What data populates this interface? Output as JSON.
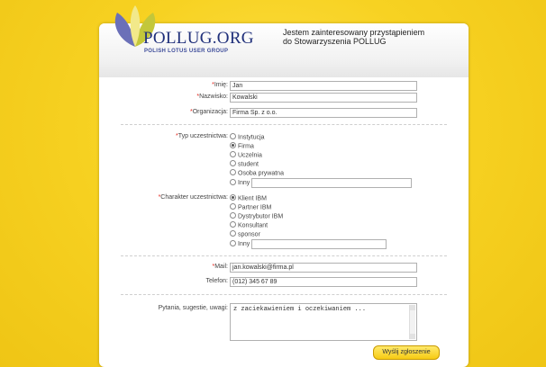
{
  "header": {
    "logo_text": "POLLUG.ORG",
    "logo_sub": "POLISH LOTUS USER GROUP",
    "title_line1": "Jestem zainteresowany przystąpieniem",
    "title_line2": "do Stowarzyszenia POLLUG"
  },
  "form": {
    "imie": {
      "label": "Imię:",
      "value": "Jan"
    },
    "nazwisko": {
      "label": "Nazwisko:",
      "value": "Kowalski"
    },
    "organizacja": {
      "label": "Organizacja:",
      "value": "Firma Sp. z o.o."
    },
    "typ": {
      "label": "Typ uczestnictwa:",
      "options": [
        "Instytucja",
        "Firma",
        "Uczelnia",
        "student",
        "Osoba prywatna",
        "Inny"
      ],
      "selected": "Firma"
    },
    "charakter": {
      "label": "Charakter uczestnictwa:",
      "options": [
        "Klient IBM",
        "Partner IBM",
        "Dystrybutor IBM",
        "Konsultant",
        "sponsor",
        "Inny"
      ],
      "selected": "Klient IBM"
    },
    "mail": {
      "label": "Mail:",
      "value": "jan.kowalski@firma.pl"
    },
    "telefon": {
      "label": "Telefon:",
      "value": "(012) 345 67 89"
    },
    "uwagi": {
      "label": "Pytania, sugestie, uwagi:",
      "value": "z zaciekawieniem i oczekiwaniem ..."
    },
    "required_mark": "*",
    "submit_label": "Wyślij zgłoszenie"
  },
  "colors": {
    "background": "#f5cf1f",
    "required": "#e2261c",
    "logo": "#1f2f7a"
  }
}
